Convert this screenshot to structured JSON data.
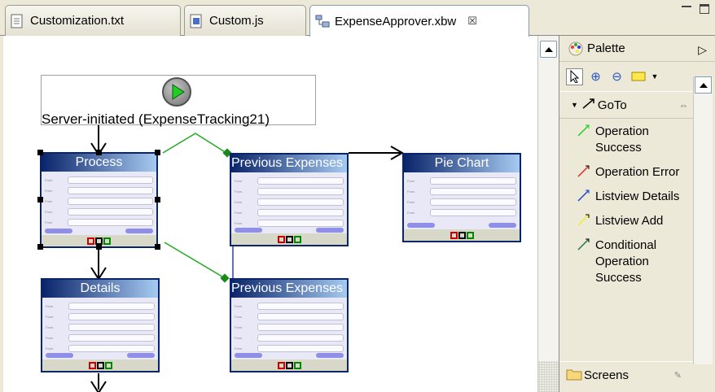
{
  "tabs": [
    {
      "label": "Customization.txt",
      "icon": "text-file-icon"
    },
    {
      "label": "Custom.js",
      "icon": "js-file-icon"
    },
    {
      "label": "ExpenseApprover.xbw",
      "icon": "workflow-file-icon",
      "active": true,
      "close": "☒"
    }
  ],
  "canvas": {
    "server_label": "Server-initiated (ExpenseTracking21)",
    "nodes": {
      "process": "Process",
      "previous1": "Previous Expenses",
      "pie": "Pie Chart",
      "details": "Details",
      "previous2": "Previous Expenses"
    }
  },
  "palette": {
    "title": "Palette",
    "drawer": "GoTo",
    "items": [
      {
        "label": "Operation Success",
        "color": "#22cc22"
      },
      {
        "label": "Operation Error",
        "color": "#ee2222"
      },
      {
        "label": "Listview Details",
        "color": "#2244cc"
      },
      {
        "label": "Listview Add",
        "color": "#eeee22"
      },
      {
        "label": "Conditional Operation Success",
        "color": "#227744"
      }
    ],
    "screens": "Screens"
  }
}
